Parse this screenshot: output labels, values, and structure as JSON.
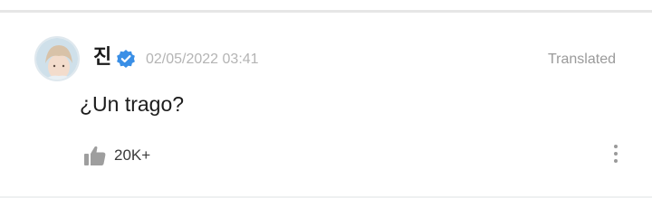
{
  "post": {
    "author": "진",
    "verified_icon": "verified-badge-icon",
    "timestamp": "02/05/2022 03:41",
    "translated_label": "Translated",
    "text": "¿Un trago?",
    "like_count": "20K+",
    "like_icon": "thumbs-up-icon",
    "more_icon": "more-vertical-icon"
  },
  "colors": {
    "verified": "#3a8fe6",
    "muted_text": "#b4b4b4",
    "primary_text": "#1c1c1c"
  }
}
